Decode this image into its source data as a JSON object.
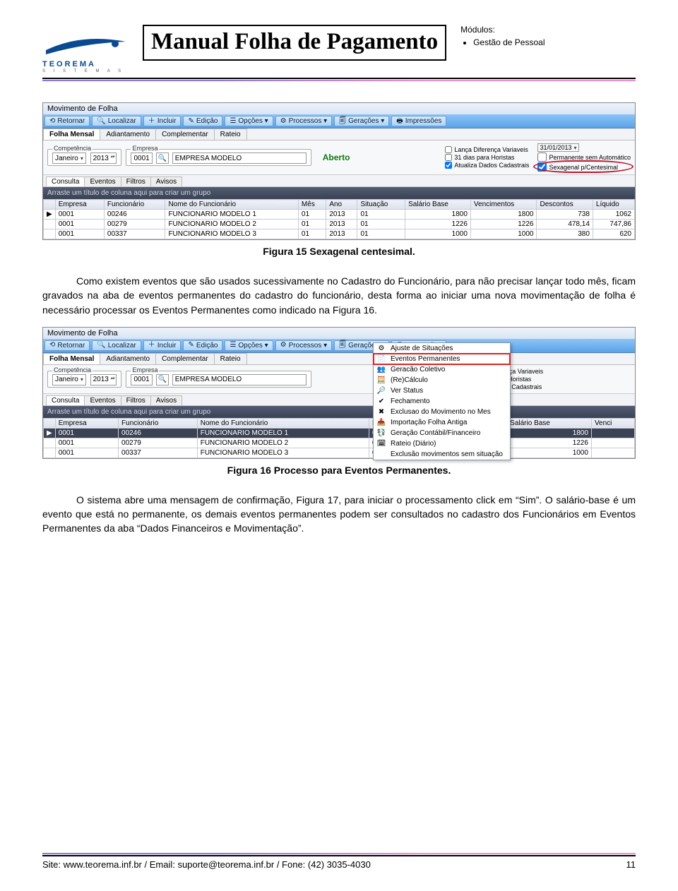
{
  "header": {
    "logo_brand": "TEOREMA",
    "logo_sub": "S I S T E M A S",
    "title": "Manual Folha de Pagamento",
    "modulos_label": "Módulos:",
    "modulos": [
      "Gestão de Pessoal"
    ]
  },
  "screenshot1": {
    "window_title": "Movimento de Folha",
    "toolbar": [
      {
        "icon": "⟲",
        "label": "Retornar"
      },
      {
        "icon": "🔍",
        "label": "Localizar"
      },
      {
        "icon": "＋",
        "label": "Incluir"
      },
      {
        "icon": "✎",
        "label": "Edição"
      },
      {
        "icon": "☰",
        "label": "Opções ▾"
      },
      {
        "icon": "⚙",
        "label": "Processos ▾"
      },
      {
        "icon": "🗐",
        "label": "Gerações ▾"
      },
      {
        "icon": "🖶",
        "label": "Impressões"
      }
    ],
    "tabs": [
      "Folha Mensal",
      "Adiantamento",
      "Complementar",
      "Rateio"
    ],
    "active_tab": "Folha Mensal",
    "competencia_legend": "Competência",
    "mes": "Janeiro",
    "ano": "2013",
    "empresa_legend": "Empresa",
    "emp_cod": "0001",
    "emp_nome": "EMPRESA MODELO",
    "status": "Aberto",
    "chk_left": [
      "Lança Diferença Variaveis",
      "31 dias para Horistas",
      "Atualiza Dados Cadastrais"
    ],
    "chk_left_checked": [
      false,
      false,
      true
    ],
    "date_right": "31/01/2013",
    "chk_right": [
      "Permanente sem Automático",
      "Sexagenal p/Centesimal"
    ],
    "chk_right_checked": [
      false,
      true
    ],
    "subtabs": [
      "Consulta",
      "Eventos",
      "Filtros",
      "Avisos"
    ],
    "active_subtab": "Consulta",
    "groupbar": "Arraste um título de coluna aqui para criar um grupo",
    "columns": [
      "Empresa",
      "Funcionário",
      "Nome do Funcionário",
      "Mês",
      "Ano",
      "Situação",
      "Salário Base",
      "Vencimentos",
      "Descontos",
      "Líquido"
    ],
    "rows": [
      [
        "0001",
        "00246",
        "FUNCIONARIO MODELO 1",
        "01",
        "2013",
        "01",
        "1800",
        "1800",
        "738",
        "1062"
      ],
      [
        "0001",
        "00279",
        "FUNCIONARIO MODELO 2",
        "01",
        "2013",
        "01",
        "1226",
        "1226",
        "478,14",
        "747,86"
      ],
      [
        "0001",
        "00337",
        "FUNCIONARIO MODELO 3",
        "01",
        "2013",
        "01",
        "1000",
        "1000",
        "380",
        "620"
      ]
    ]
  },
  "caption1": "Figura 15 Sexagenal centesimal.",
  "para1": "Como existem eventos que são usados sucessivamente no Cadastro do Funcionário, para não precisar lançar todo mês, ficam gravados na aba de eventos permanentes do cadastro do funcionário, desta forma ao iniciar uma nova movimentação de folha é necessário processar os Eventos Permanentes como indicado na Figura 16.",
  "screenshot2": {
    "window_title": "Movimento de Folha",
    "toolbar": [
      {
        "icon": "⟲",
        "label": "Retornar"
      },
      {
        "icon": "🔍",
        "label": "Localizar"
      },
      {
        "icon": "＋",
        "label": "Incluir"
      },
      {
        "icon": "✎",
        "label": "Edição"
      },
      {
        "icon": "☰",
        "label": "Opções ▾"
      },
      {
        "icon": "⚙",
        "label": "Processos ▾"
      },
      {
        "icon": "🗐",
        "label": "Gerações ▾"
      },
      {
        "icon": "🖶",
        "label": "Impressões"
      }
    ],
    "tabs": [
      "Folha Mensal",
      "Adiantamento",
      "Complementar",
      "Rateio"
    ],
    "active_tab": "Folha Mensal",
    "competencia_legend": "Competência",
    "mes": "Janeiro",
    "ano": "2013",
    "empresa_legend": "Empresa",
    "emp_cod": "0001",
    "emp_nome": "EMPRESA MODELO",
    "chk_visible": [
      "ça Diferença Variaveis",
      "dias para Horistas",
      "liza Dados Cadastrais"
    ],
    "subtabs": [
      "Consulta",
      "Eventos",
      "Filtros",
      "Avisos"
    ],
    "active_subtab": "Consulta",
    "groupbar": "Arraste um título de coluna aqui para criar um grupo",
    "columns": [
      "Empresa",
      "Funcionário",
      "Nome do Funcionário",
      "Mês",
      "Ano",
      "Situação",
      "Salário Base",
      "Venci"
    ],
    "rows": [
      [
        "0001",
        "00246",
        "FUNCIONARIO MODELO 1",
        "01",
        "2013",
        "01",
        "1800",
        ""
      ],
      [
        "0001",
        "00279",
        "FUNCIONARIO MODELO 2",
        "01",
        "2013",
        "01",
        "1226",
        ""
      ],
      [
        "0001",
        "00337",
        "FUNCIONARIO MODELO 3",
        "01",
        "2013",
        "01",
        "1000",
        ""
      ]
    ],
    "menu_items": [
      {
        "icon": "⚙",
        "label": "Ajuste de Situações"
      },
      {
        "icon": "📄",
        "label": "Eventos Permanentes",
        "highlight": true
      },
      {
        "icon": "👥",
        "label": "Geracão Coletivo"
      },
      {
        "icon": "🧮",
        "label": "(Re)Cálculo"
      },
      {
        "icon": "🔎",
        "label": "Ver Status"
      },
      {
        "icon": "✔",
        "label": "Fechamento"
      },
      {
        "icon": "✖",
        "label": "Exclusao do Movimento no Mes"
      },
      {
        "icon": "📥",
        "label": "Importação Folha Antiga"
      },
      {
        "icon": "💱",
        "label": "Geração Contábil/Financeiro"
      },
      {
        "icon": "🗓",
        "label": "Rateio (Diário)"
      },
      {
        "icon": "",
        "label": "Exclusão movimentos sem situação"
      }
    ]
  },
  "caption2": "Figura 16 Processo para Eventos Permanentes.",
  "para2": "O sistema abre uma mensagem de confirmação, Figura 17, para iniciar o processamento click em “Sim”. O salário-base é um evento que está no permanente, os demais eventos permanentes podem ser consultados no cadastro dos Funcionários em Eventos Permanentes da aba “Dados Financeiros e Movimentação”.",
  "footer": {
    "line": "Site: www.teorema.inf.br / Email: suporte@teorema.inf.br / Fone: (42) 3035-4030",
    "page": "11"
  }
}
